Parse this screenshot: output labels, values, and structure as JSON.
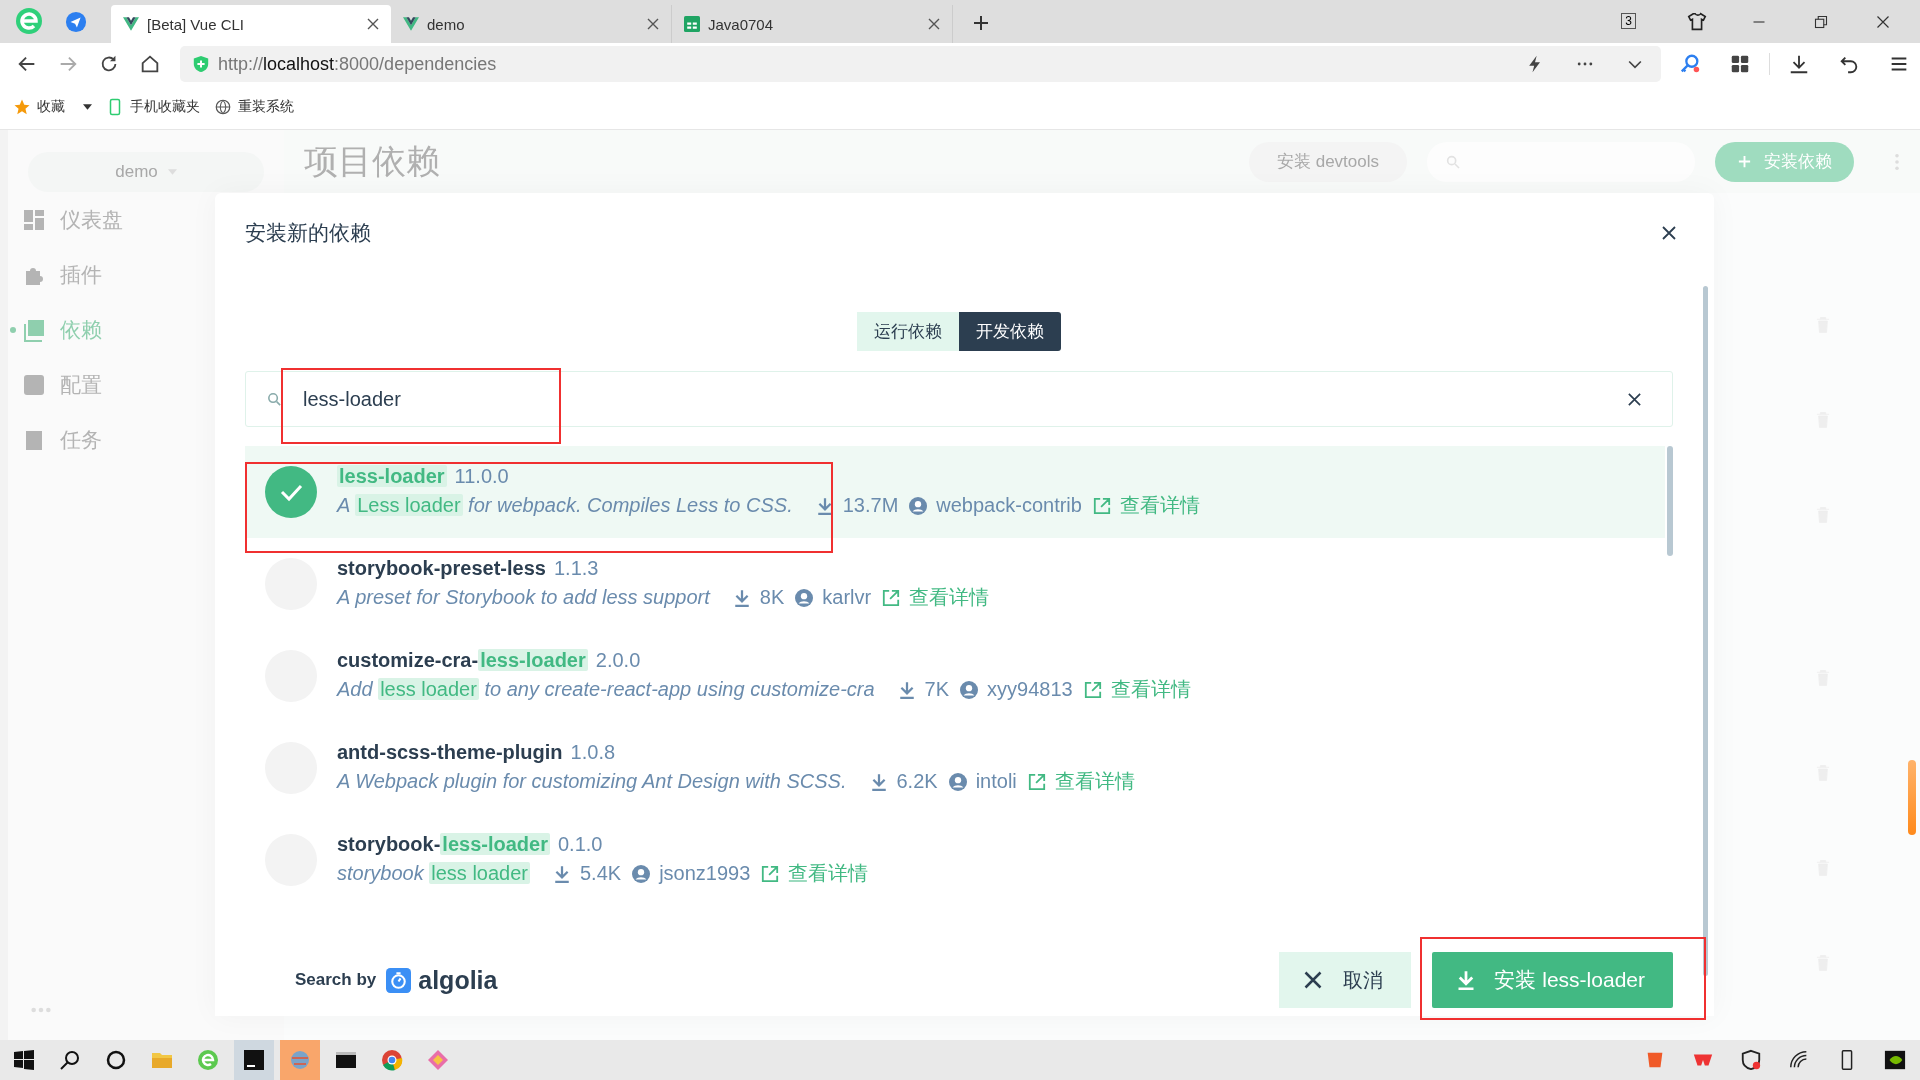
{
  "browser": {
    "tabs": [
      {
        "title": "[Beta] Vue CLI",
        "selected": true
      },
      {
        "title": "demo",
        "selected": false
      },
      {
        "title": "Java0704",
        "selected": false
      }
    ],
    "tab_count": "3",
    "url": {
      "scheme": "http://",
      "host": "localhost",
      "rest": ":8000/dependencies"
    },
    "bookmarks": [
      "收藏",
      "手机收藏夹",
      "重装系统"
    ]
  },
  "app": {
    "project": "demo",
    "page_title": "项目依赖",
    "nav": [
      {
        "label": "仪表盘",
        "selected": false
      },
      {
        "label": "插件",
        "selected": false
      },
      {
        "label": "依赖",
        "selected": true
      },
      {
        "label": "配置",
        "selected": false
      },
      {
        "label": "任务",
        "selected": false
      }
    ],
    "devtools_button": "安装 devtools",
    "add_button": "安装依赖"
  },
  "dialog": {
    "title": "安装新的依赖",
    "types": [
      {
        "label": "运行依赖",
        "selected": false
      },
      {
        "label": "开发依赖",
        "selected": true
      }
    ],
    "search": {
      "value": "less-loader"
    },
    "results": [
      {
        "name": [
          {
            "text": "less-loader",
            "hit": true
          }
        ],
        "version": "11.0.0",
        "description": [
          {
            "text": "A ",
            "hit": false
          },
          {
            "text": "Less loader",
            "hit": true
          },
          {
            "text": " for webpack. Compiles Less to CSS.",
            "hit": false
          }
        ],
        "downloads": "13.7M",
        "author": "webpack-contrib",
        "link": "查看详情",
        "selected": true
      },
      {
        "name": [
          {
            "text": "storybook-preset-less",
            "hit": false
          }
        ],
        "version": "1.1.3",
        "description": [
          {
            "text": "A preset for Storybook to add less support",
            "hit": false
          }
        ],
        "downloads": "8K",
        "author": "karlvr",
        "link": "查看详情",
        "selected": false
      },
      {
        "name": [
          {
            "text": "customize-cra-",
            "hit": false
          },
          {
            "text": "less-loader",
            "hit": true
          }
        ],
        "version": "2.0.0",
        "description": [
          {
            "text": "Add ",
            "hit": false
          },
          {
            "text": "less loader",
            "hit": true
          },
          {
            "text": " to any create-react-app using customize-cra",
            "hit": false
          }
        ],
        "downloads": "7K",
        "author": "xyy94813",
        "link": "查看详情",
        "selected": false
      },
      {
        "name": [
          {
            "text": "antd-scss-theme-plugin",
            "hit": false
          }
        ],
        "version": "1.0.8",
        "description": [
          {
            "text": "A Webpack plugin for customizing Ant Design with SCSS.",
            "hit": false
          }
        ],
        "downloads": "6.2K",
        "author": "intoli",
        "link": "查看详情",
        "selected": false
      },
      {
        "name": [
          {
            "text": "storybook-",
            "hit": false
          },
          {
            "text": "less-loader",
            "hit": true
          }
        ],
        "version": "0.1.0",
        "description": [
          {
            "text": "storybook ",
            "hit": false
          },
          {
            "text": "less loader",
            "hit": true
          }
        ],
        "downloads": "5.4K",
        "author": "jsonz1993",
        "link": "查看详情",
        "selected": false
      }
    ],
    "search_by": "Search by",
    "algolia": "algolia",
    "cancel_button": "取消",
    "install_button": "安装 less-loader"
  }
}
